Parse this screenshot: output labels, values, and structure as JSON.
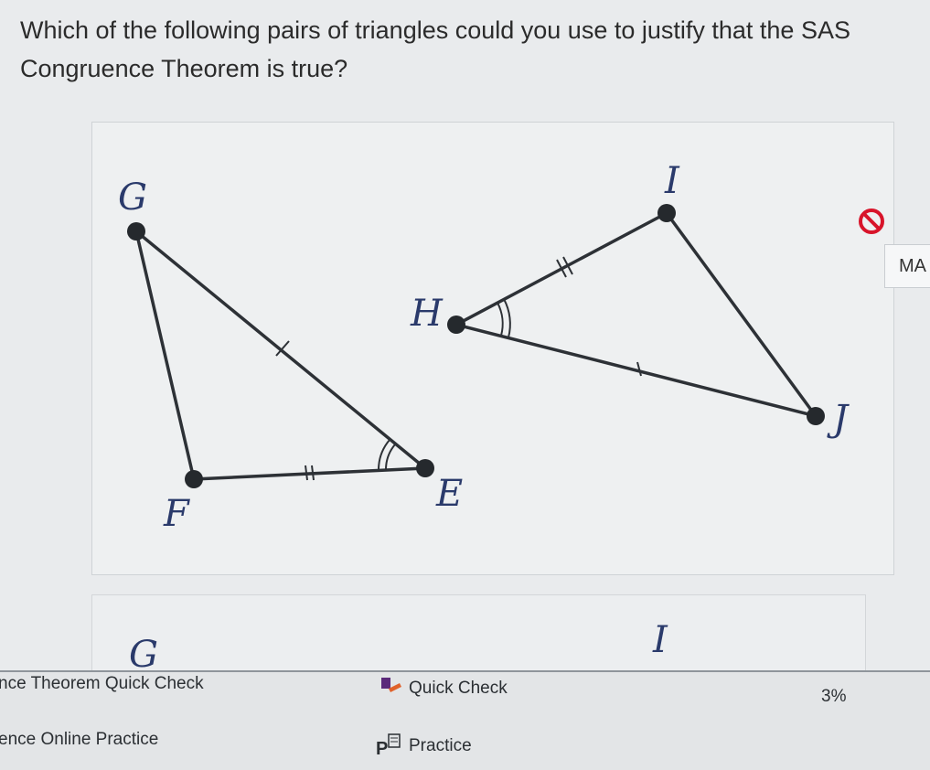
{
  "question": {
    "text": "Which of the following pairs of triangles could you use to justify that the SAS Congruence Theorem is true?"
  },
  "figure": {
    "labels": {
      "G": "G",
      "F": "F",
      "E": "E",
      "H": "H",
      "I": "I",
      "J": "J"
    }
  },
  "side_tab": {
    "label": "MA"
  },
  "second_choice": {
    "labels": {
      "G": "G",
      "I": "I"
    }
  },
  "taskbar": {
    "quick_check_left": "nce Theorem Quick Check",
    "quick_check_mid": "Quick Check",
    "percent": "3%",
    "online_practice": "ence Online Practice",
    "practice": "Practice"
  },
  "colors": {
    "edge": "#2d3136",
    "vertex": "#25292d",
    "label": "#2a3a6b",
    "flag": "#d8142a"
  },
  "icons": [
    "no-entry-icon",
    "quick-check-icon",
    "practice-icon"
  ]
}
